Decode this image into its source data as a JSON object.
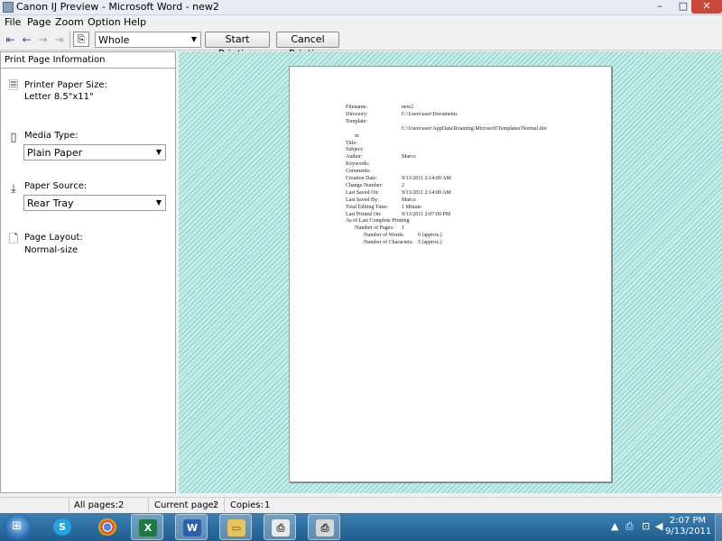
{
  "window": {
    "title": "Canon IJ Preview - Microsoft Word - new2",
    "controls": {
      "minimize": "–",
      "maximize": "□",
      "close": "✕"
    }
  },
  "menu": [
    "File",
    "Page",
    "Zoom",
    "Option",
    "Help"
  ],
  "toolbar": {
    "zoom_value": "Whole",
    "start_printing": "Start Printing",
    "cancel_printing": "Cancel Printing"
  },
  "panel": {
    "header": "Print Page Information",
    "printer_paper_size": {
      "label": "Printer Paper Size:",
      "value": "Letter 8.5\"x11\""
    },
    "media_type": {
      "label": "Media Type:",
      "value": "Plain Paper"
    },
    "paper_source": {
      "label": "Paper Source:",
      "value": "Rear Tray"
    },
    "page_layout": {
      "label": "Page Layout:",
      "value": "Normal-size"
    }
  },
  "document": {
    "lines": [
      {
        "label": "Filename:",
        "value": "new2"
      },
      {
        "label": "Directory:",
        "value": "C:\\Users\\user\\Documents"
      },
      {
        "label": "Template:",
        "value": ""
      },
      {
        "label": "",
        "value": "C:\\Users\\user\\AppData\\Roaming\\Microsoft\\Templates\\Normal.dot"
      },
      {
        "label": "m",
        "value": ""
      },
      {
        "label": "Title:",
        "value": ""
      },
      {
        "label": "Subject:",
        "value": ""
      },
      {
        "label": "Author:",
        "value": "Marco"
      },
      {
        "label": "Keywords:",
        "value": ""
      },
      {
        "label": "Comments:",
        "value": ""
      },
      {
        "label": "Creation Date:",
        "value": "9/13/2011 2:14:00 AM"
      },
      {
        "label": "Change Number:",
        "value": "2"
      },
      {
        "label": "Last Saved On:",
        "value": "9/13/2011 2:14:00 AM"
      },
      {
        "label": "Last Saved By:",
        "value": "Marco"
      },
      {
        "label": "Total Editing Time:",
        "value": "1 Minute"
      },
      {
        "label": "Last Printed On:",
        "value": "9/13/2011 2:07:00 PM"
      },
      {
        "label": "As of Last Complete Printing",
        "value": ""
      },
      {
        "label": "Number of Pages:",
        "value": "1"
      },
      {
        "label": "Number of Words:",
        "value": "0 (approx.)"
      },
      {
        "label": "Number of Characters:",
        "value": "5 (approx.)"
      }
    ]
  },
  "status": {
    "all_pages_label": "All pages:",
    "all_pages_value": "2",
    "current_page_label": "Current page:",
    "current_page_value": "2",
    "copies_label": "Copies:",
    "copies_value": "1"
  },
  "taskbar": {
    "apps": [
      "skype-icon",
      "chrome-icon",
      "excel-icon",
      "word-icon",
      "explorer-icon",
      "canon-preview-icon",
      "printer-icon"
    ],
    "clock_time": "2:07 PM",
    "clock_date": "9/13/2011"
  }
}
